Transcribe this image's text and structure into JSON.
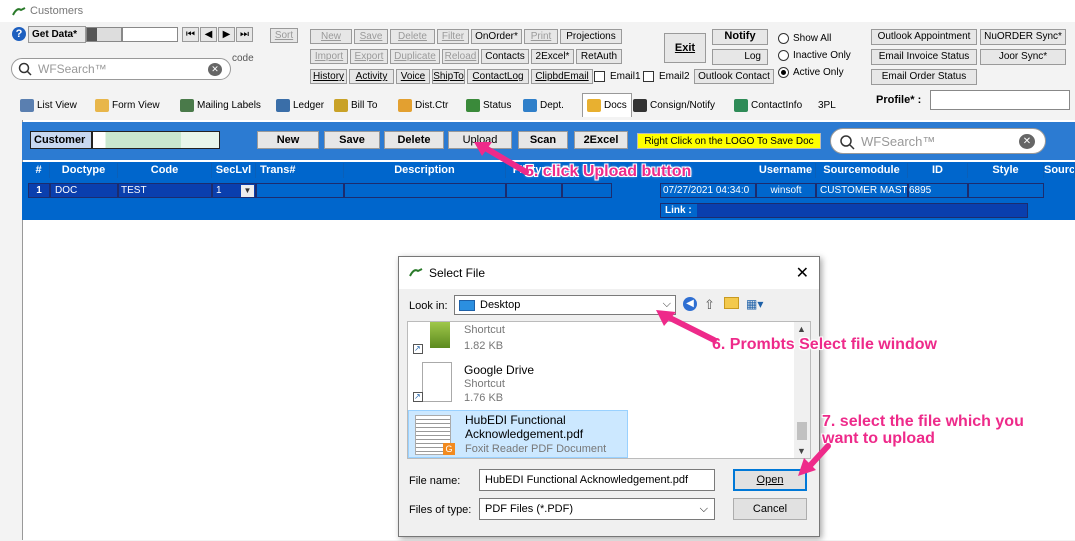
{
  "window": {
    "title": "Customers"
  },
  "toolbar": {
    "get_data": "Get Data*",
    "sort": "Sort",
    "code_label": "code",
    "search_placeholder": "WFSearch™",
    "row1": [
      "New",
      "Save",
      "Delete",
      "Filter",
      "OnOrder*",
      "Print",
      "Projections"
    ],
    "row2": [
      "Import",
      "Export",
      "Duplicate",
      "Reload",
      "Contacts",
      "2Excel*",
      "RetAuth"
    ],
    "row3": [
      "History",
      "Activity",
      "Voice",
      "ShipTo",
      "ContactLog",
      "ClipbdEmail"
    ],
    "email1": "Email1",
    "email2": "Email2",
    "outlook_contact": "Outlook Contact",
    "exit": "Exit",
    "notify": "Notify",
    "log": "Log",
    "radios": [
      {
        "label": "Show All",
        "checked": false
      },
      {
        "label": "Inactive Only",
        "checked": false
      },
      {
        "label": "Active Only",
        "checked": true
      }
    ],
    "right_buttons": [
      "Outlook Appointment",
      "NuORDER Sync*",
      "Email Invoice Status",
      "Joor Sync*",
      "Email Order Status"
    ],
    "profile_label": "Profile* :"
  },
  "tabs": [
    "List View",
    "Form View",
    "Mailing Labels",
    "Ledger",
    "Bill To",
    "Dist.Ctr",
    "Status",
    "Dept.",
    "Docs",
    "Consign/Notify",
    "ContactInfo",
    "3PL"
  ],
  "docs": {
    "customer_label": "Customer",
    "buttons": [
      "New",
      "Save",
      "Delete",
      "Upload",
      "Scan",
      "2Excel"
    ],
    "logo_hint": "Right Click on the LOGO To Save Doc",
    "search_placeholder": "WFSearch™",
    "columns": [
      "#",
      "Doctype",
      "Code",
      "SecLvl",
      "Trans#",
      "Description",
      "Filetype",
      "F",
      "Username",
      "Sourcemodule",
      "ID",
      "Style",
      "Sourc"
    ],
    "row": {
      "num": "1",
      "doctype": "DOC",
      "code": "TEST",
      "seclvl": "1",
      "date": "07/27/2021 04:34:0",
      "username": "winsoft",
      "sourcemodule": "CUSTOMER MAST",
      "id": "6895"
    },
    "link_label": "Link :"
  },
  "dialog": {
    "title": "Select File",
    "look_in_label": "Look in:",
    "look_in_value": "Desktop",
    "files": [
      {
        "name": "",
        "type": "Shortcut",
        "size": "1.82 KB"
      },
      {
        "name": "Google Drive",
        "type": "Shortcut",
        "size": "1.76 KB"
      },
      {
        "name": "HubEDI Functional Acknowledgement.pdf",
        "type": "Foxit Reader PDF Document",
        "size": ""
      }
    ],
    "file_name_label": "File name:",
    "file_name_value": "HubEDI Functional Acknowledgement.pdf",
    "files_of_type_label": "Files of type:",
    "files_of_type_value": "PDF Files (*.PDF)",
    "open": "Open",
    "cancel": "Cancel"
  },
  "annotations": {
    "a5": "5. click Upload button",
    "a6": "6. Prombts Select file window",
    "a7": "7. select the file which you want to upload"
  },
  "colors": {
    "grid_blue": "#0066cc",
    "row_blue": "#0a3fae",
    "accent_pink": "#ee2a8a",
    "docs_bar": "#2c7bd2",
    "hint_yellow": "#ffff00"
  }
}
